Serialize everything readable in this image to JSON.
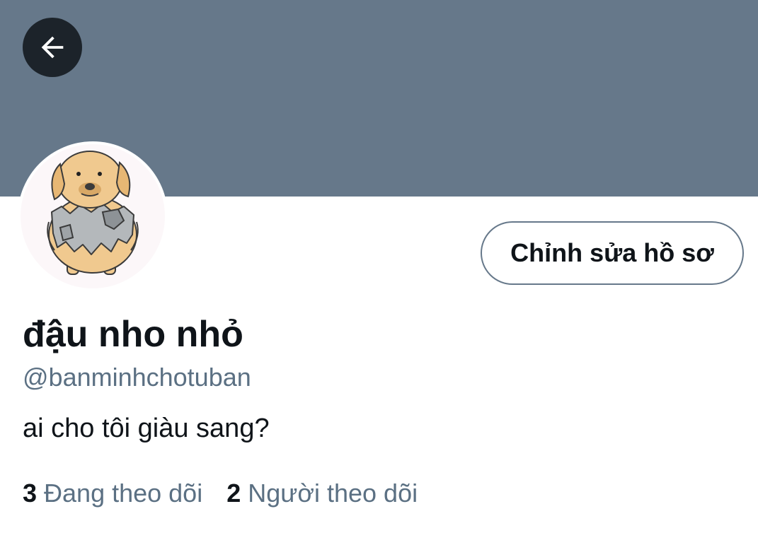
{
  "header": {
    "back_icon": "arrow-left-icon",
    "banner_color": "#66788a"
  },
  "profile": {
    "avatar_icon": "dog-sticker-avatar",
    "edit_button_label": "Chỉnh sửa hồ sơ",
    "display_name": "đậu nho nhỏ",
    "handle": "@banminhchotuban",
    "bio": "ai cho tôi giàu sang?"
  },
  "stats": {
    "following_count": "3",
    "following_label": "Đang theo dõi",
    "followers_count": "2",
    "followers_label": "Người theo dõi"
  },
  "colors": {
    "text_primary": "#0f1419",
    "text_secondary": "#5b7083",
    "border": "#66788a"
  }
}
